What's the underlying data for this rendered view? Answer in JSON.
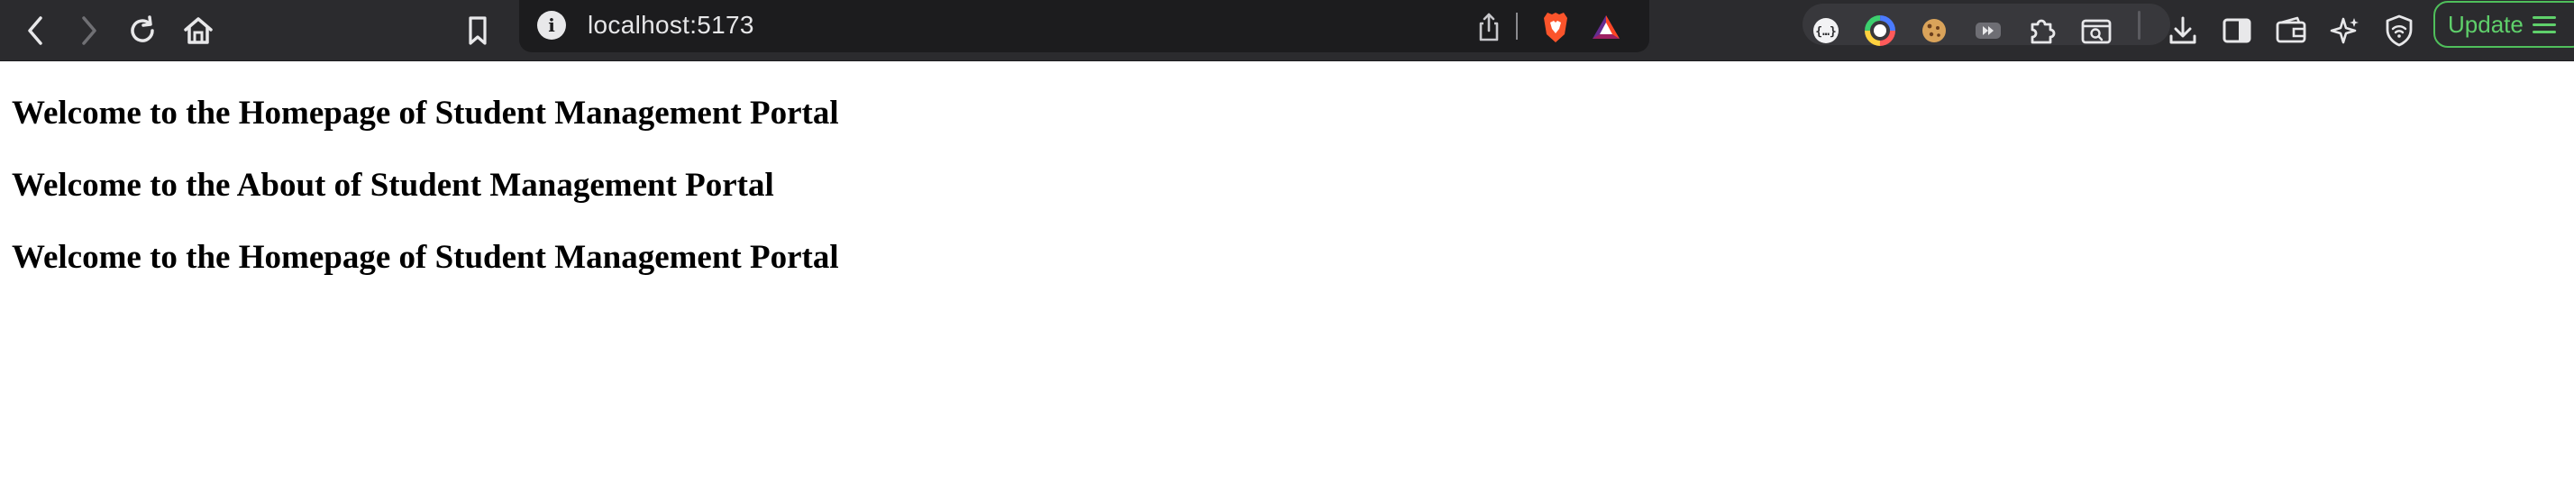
{
  "browser": {
    "url": "localhost:5173",
    "update_label": "Update",
    "nav": {
      "back_icon": "chevron-left-icon",
      "forward_icon": "chevron-right-icon",
      "reload_icon": "reload-icon",
      "home_icon": "home-icon",
      "bookmark_icon": "bookmark-icon"
    },
    "address_icons": [
      "info-icon",
      "share-icon",
      "brave-shields-icon",
      "brave-rewards-icon"
    ],
    "extensions": [
      "ext-json-icon",
      "ext-color-picker-icon",
      "ext-cookie-icon",
      "ext-media-icon",
      "puzzle-extensions-icon",
      "ext-search-icon"
    ],
    "right_icons": [
      "download-icon",
      "sidebar-icon",
      "wallet-icon",
      "leo-ai-icon",
      "vpn-icon"
    ],
    "colors": {
      "toolbar_bg": "#2b2b2e",
      "urlbar_bg": "#1c1c1e",
      "update_accent": "#5fd06b"
    }
  },
  "page": {
    "headings": [
      "Welcome to the Homepage of Student Management Portal",
      "Welcome to the About of Student Management Portal",
      "Welcome to the Homepage of Student Management Portal"
    ]
  }
}
